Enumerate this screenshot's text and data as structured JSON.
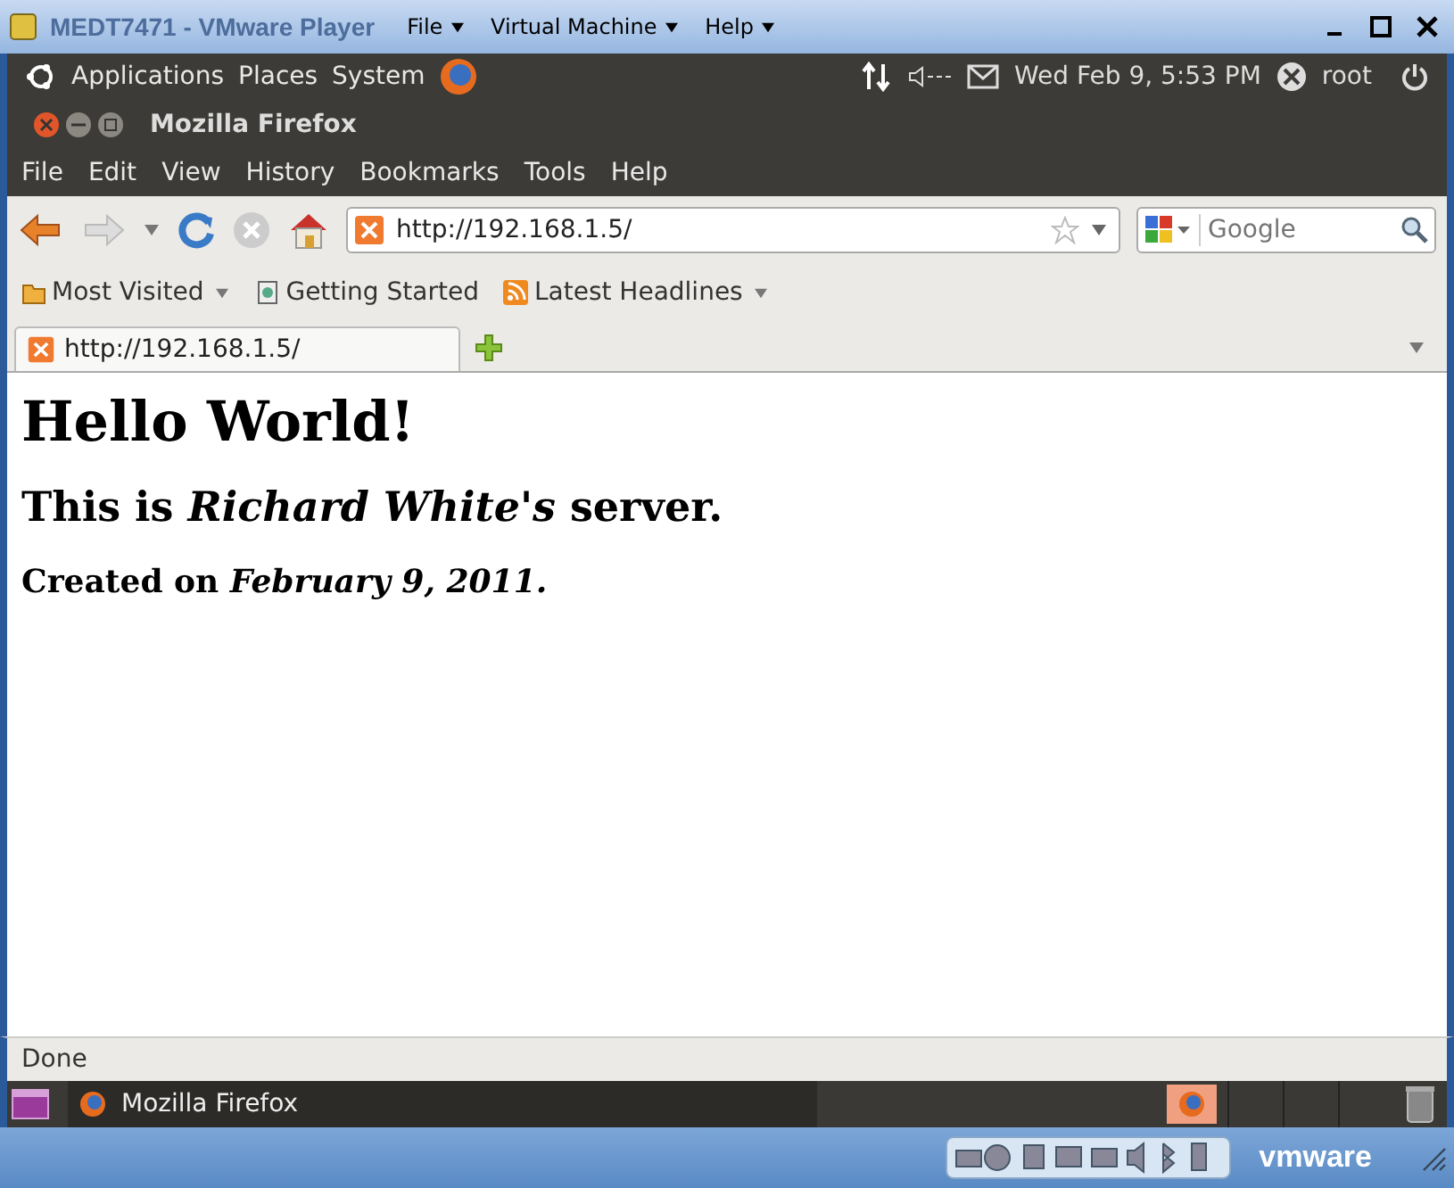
{
  "vm_window": {
    "title": "MEDT7471 - VMware Player",
    "menus": [
      "File",
      "Virtual Machine",
      "Help"
    ]
  },
  "top_panel": {
    "menus": [
      "Applications",
      "Places",
      "System"
    ],
    "clock": "Wed Feb  9,  5:53 PM",
    "user": "root"
  },
  "firefox": {
    "title": "Mozilla Firefox",
    "menu": [
      "File",
      "Edit",
      "View",
      "History",
      "Bookmarks",
      "Tools",
      "Help"
    ],
    "url": "http://192.168.1.5/",
    "search_placeholder": "Google",
    "bookmarks": [
      {
        "label": "Most Visited",
        "kind": "folder"
      },
      {
        "label": "Getting Started",
        "kind": "page"
      },
      {
        "label": "Latest Headlines",
        "kind": "feed"
      }
    ],
    "tabs": [
      {
        "label": "http://192.168.1.5/",
        "selected": true
      }
    ],
    "page": {
      "heading": "Hello World!",
      "line_1": "This is *Richard White's* server.",
      "line_2": "Created on *February 9, 2011.*"
    },
    "status": "Done"
  },
  "taskbar": {
    "items": [
      {
        "label": "Mozilla Firefox",
        "selected": false
      }
    ]
  },
  "vm_footer": {
    "logo": "vmware"
  }
}
